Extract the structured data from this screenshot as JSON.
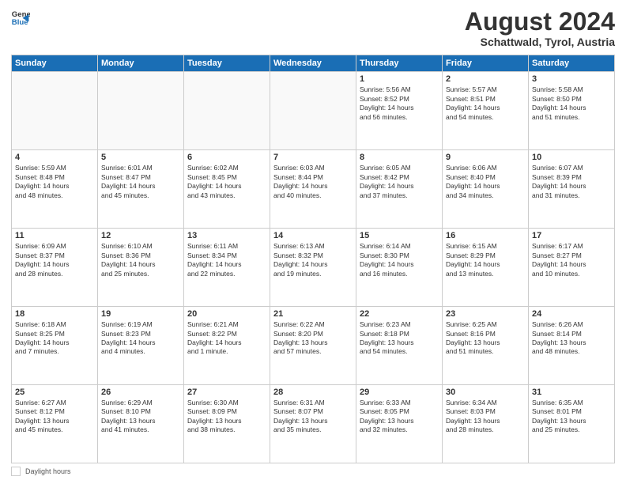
{
  "logo": {
    "general": "General",
    "blue": "Blue"
  },
  "header": {
    "title": "August 2024",
    "location": "Schattwald, Tyrol, Austria"
  },
  "days_of_week": [
    "Sunday",
    "Monday",
    "Tuesday",
    "Wednesday",
    "Thursday",
    "Friday",
    "Saturday"
  ],
  "footer": {
    "label": "Daylight hours"
  },
  "weeks": [
    [
      {
        "day": "",
        "info": ""
      },
      {
        "day": "",
        "info": ""
      },
      {
        "day": "",
        "info": ""
      },
      {
        "day": "",
        "info": ""
      },
      {
        "day": "1",
        "info": "Sunrise: 5:56 AM\nSunset: 8:52 PM\nDaylight: 14 hours\nand 56 minutes."
      },
      {
        "day": "2",
        "info": "Sunrise: 5:57 AM\nSunset: 8:51 PM\nDaylight: 14 hours\nand 54 minutes."
      },
      {
        "day": "3",
        "info": "Sunrise: 5:58 AM\nSunset: 8:50 PM\nDaylight: 14 hours\nand 51 minutes."
      }
    ],
    [
      {
        "day": "4",
        "info": "Sunrise: 5:59 AM\nSunset: 8:48 PM\nDaylight: 14 hours\nand 48 minutes."
      },
      {
        "day": "5",
        "info": "Sunrise: 6:01 AM\nSunset: 8:47 PM\nDaylight: 14 hours\nand 45 minutes."
      },
      {
        "day": "6",
        "info": "Sunrise: 6:02 AM\nSunset: 8:45 PM\nDaylight: 14 hours\nand 43 minutes."
      },
      {
        "day": "7",
        "info": "Sunrise: 6:03 AM\nSunset: 8:44 PM\nDaylight: 14 hours\nand 40 minutes."
      },
      {
        "day": "8",
        "info": "Sunrise: 6:05 AM\nSunset: 8:42 PM\nDaylight: 14 hours\nand 37 minutes."
      },
      {
        "day": "9",
        "info": "Sunrise: 6:06 AM\nSunset: 8:40 PM\nDaylight: 14 hours\nand 34 minutes."
      },
      {
        "day": "10",
        "info": "Sunrise: 6:07 AM\nSunset: 8:39 PM\nDaylight: 14 hours\nand 31 minutes."
      }
    ],
    [
      {
        "day": "11",
        "info": "Sunrise: 6:09 AM\nSunset: 8:37 PM\nDaylight: 14 hours\nand 28 minutes."
      },
      {
        "day": "12",
        "info": "Sunrise: 6:10 AM\nSunset: 8:36 PM\nDaylight: 14 hours\nand 25 minutes."
      },
      {
        "day": "13",
        "info": "Sunrise: 6:11 AM\nSunset: 8:34 PM\nDaylight: 14 hours\nand 22 minutes."
      },
      {
        "day": "14",
        "info": "Sunrise: 6:13 AM\nSunset: 8:32 PM\nDaylight: 14 hours\nand 19 minutes."
      },
      {
        "day": "15",
        "info": "Sunrise: 6:14 AM\nSunset: 8:30 PM\nDaylight: 14 hours\nand 16 minutes."
      },
      {
        "day": "16",
        "info": "Sunrise: 6:15 AM\nSunset: 8:29 PM\nDaylight: 14 hours\nand 13 minutes."
      },
      {
        "day": "17",
        "info": "Sunrise: 6:17 AM\nSunset: 8:27 PM\nDaylight: 14 hours\nand 10 minutes."
      }
    ],
    [
      {
        "day": "18",
        "info": "Sunrise: 6:18 AM\nSunset: 8:25 PM\nDaylight: 14 hours\nand 7 minutes."
      },
      {
        "day": "19",
        "info": "Sunrise: 6:19 AM\nSunset: 8:23 PM\nDaylight: 14 hours\nand 4 minutes."
      },
      {
        "day": "20",
        "info": "Sunrise: 6:21 AM\nSunset: 8:22 PM\nDaylight: 14 hours\nand 1 minute."
      },
      {
        "day": "21",
        "info": "Sunrise: 6:22 AM\nSunset: 8:20 PM\nDaylight: 13 hours\nand 57 minutes."
      },
      {
        "day": "22",
        "info": "Sunrise: 6:23 AM\nSunset: 8:18 PM\nDaylight: 13 hours\nand 54 minutes."
      },
      {
        "day": "23",
        "info": "Sunrise: 6:25 AM\nSunset: 8:16 PM\nDaylight: 13 hours\nand 51 minutes."
      },
      {
        "day": "24",
        "info": "Sunrise: 6:26 AM\nSunset: 8:14 PM\nDaylight: 13 hours\nand 48 minutes."
      }
    ],
    [
      {
        "day": "25",
        "info": "Sunrise: 6:27 AM\nSunset: 8:12 PM\nDaylight: 13 hours\nand 45 minutes."
      },
      {
        "day": "26",
        "info": "Sunrise: 6:29 AM\nSunset: 8:10 PM\nDaylight: 13 hours\nand 41 minutes."
      },
      {
        "day": "27",
        "info": "Sunrise: 6:30 AM\nSunset: 8:09 PM\nDaylight: 13 hours\nand 38 minutes."
      },
      {
        "day": "28",
        "info": "Sunrise: 6:31 AM\nSunset: 8:07 PM\nDaylight: 13 hours\nand 35 minutes."
      },
      {
        "day": "29",
        "info": "Sunrise: 6:33 AM\nSunset: 8:05 PM\nDaylight: 13 hours\nand 32 minutes."
      },
      {
        "day": "30",
        "info": "Sunrise: 6:34 AM\nSunset: 8:03 PM\nDaylight: 13 hours\nand 28 minutes."
      },
      {
        "day": "31",
        "info": "Sunrise: 6:35 AM\nSunset: 8:01 PM\nDaylight: 13 hours\nand 25 minutes."
      }
    ]
  ]
}
